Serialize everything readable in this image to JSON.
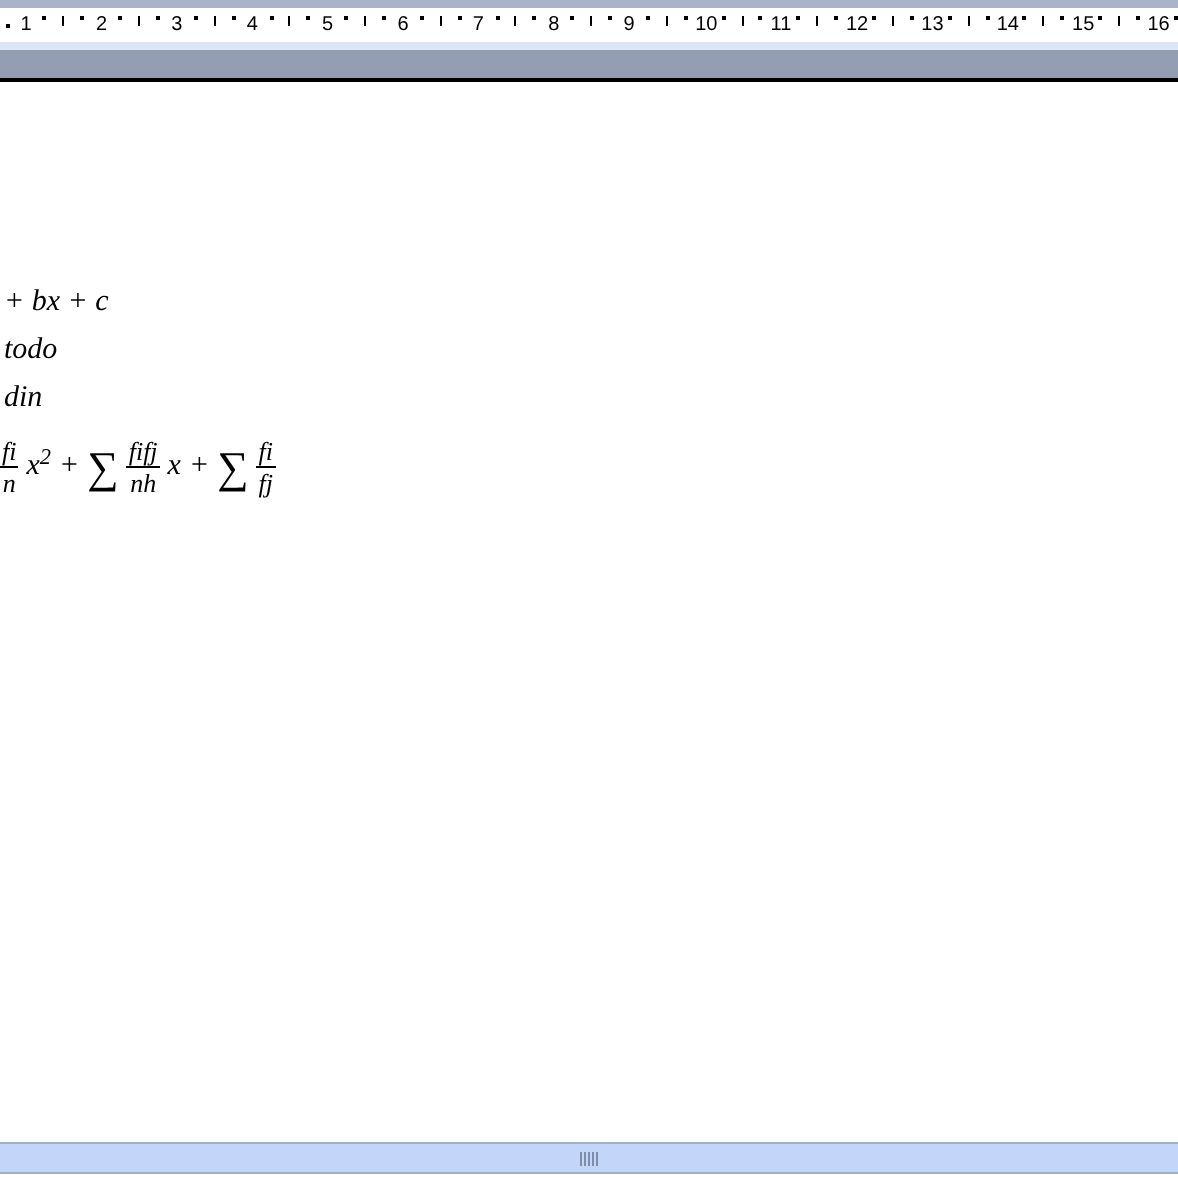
{
  "ruler": {
    "numbers": [
      "1",
      "2",
      "3",
      "4",
      "5",
      "6",
      "7",
      "8",
      "9",
      "10",
      "11",
      "12",
      "13",
      "14",
      "15",
      "16"
    ]
  },
  "document": {
    "lines": [
      {
        "kind": "text",
        "text": "+ bx + c"
      },
      {
        "kind": "text",
        "text": "todo"
      },
      {
        "kind": "text",
        "text": "din"
      },
      {
        "kind": "formula",
        "parts": [
          {
            "kind": "fraction",
            "num": "fi",
            "den": "n"
          },
          {
            "kind": "text",
            "text": "x$^{2}$"
          },
          {
            "kind": "text",
            "text": "+"
          },
          {
            "kind": "sum",
            "text": "∑"
          },
          {
            "kind": "fraction",
            "num": "fifj",
            "den": "nh"
          },
          {
            "kind": "text",
            "text": "x"
          },
          {
            "kind": "text",
            "text": "+"
          },
          {
            "kind": "sum",
            "text": "∑"
          },
          {
            "kind": "fraction",
            "num": "fi",
            "den": "fj"
          }
        ]
      }
    ]
  }
}
